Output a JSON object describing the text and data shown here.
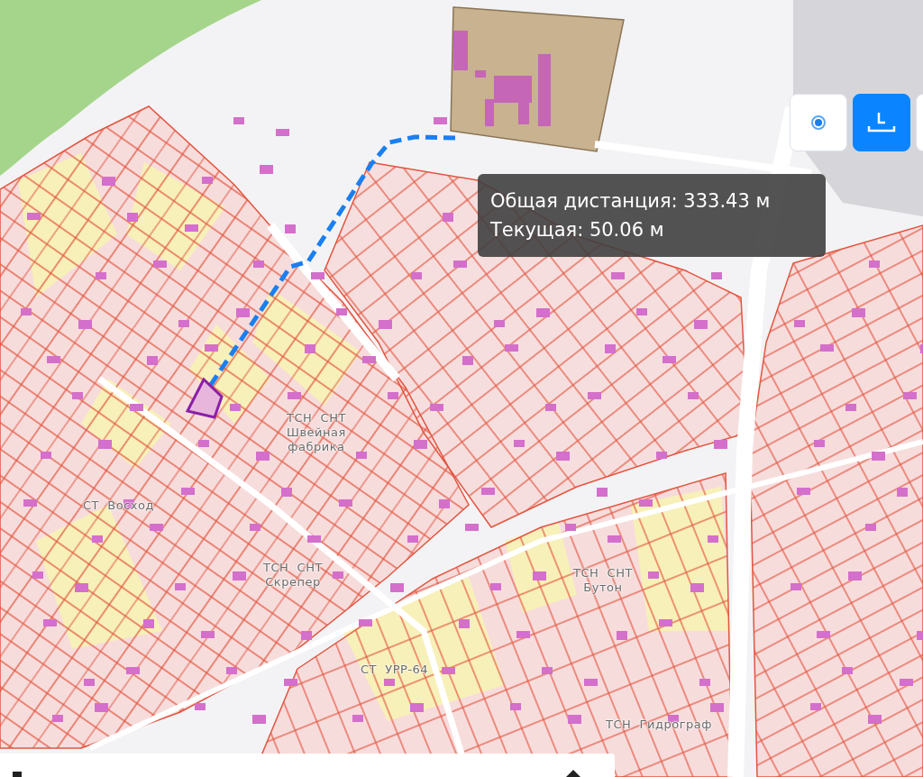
{
  "map": {
    "labels": [
      {
        "text": "ТСН  СНТ\nШвейная\nфабрика"
      },
      {
        "text": "СТ  Восход"
      },
      {
        "text": "ТСН  СНТ\nСкрепер"
      },
      {
        "text": "ТСН  СНТ\nБутон"
      },
      {
        "text": "СТ  УРР-64"
      },
      {
        "text": "ТСН  Гидрограф"
      }
    ]
  },
  "measure_tooltip": {
    "lines": [
      "Общая дистанция: 333.43 м",
      "Текущая: 50.06 м"
    ]
  },
  "controls": [
    {
      "kind": "locate",
      "selected": false
    },
    {
      "kind": "ruler",
      "selected": true
    }
  ]
}
